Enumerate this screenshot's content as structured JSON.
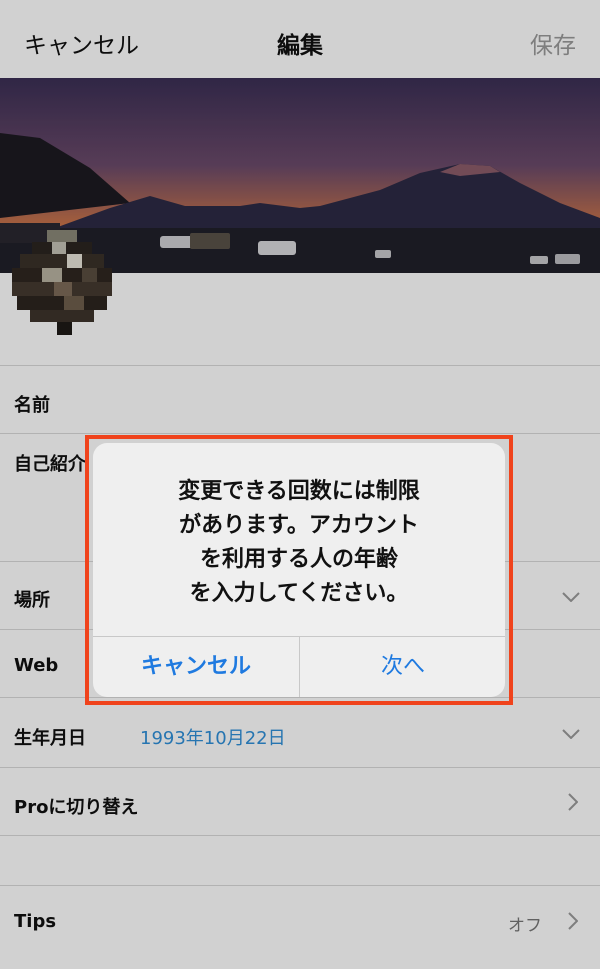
{
  "nav": {
    "cancel_label": "キャンセル",
    "title": "編集",
    "save_label": "保存"
  },
  "rows": {
    "name_label": "名前",
    "bio_label": "自己紹介",
    "location_label": "場所",
    "web_label": "Web",
    "birthday_label": "生年月日",
    "birthday_value": "1993年10月22日",
    "pro_label": "Proに切り替え",
    "tips_label": "Tips",
    "tips_value": "オフ"
  },
  "dialog": {
    "message_lines": [
      "変更できる回数には制限",
      "があります。アカウント",
      "を利用する人の年齢",
      "を入力してください。"
    ],
    "cancel_label": "キャンセル",
    "next_label": "次へ"
  },
  "colors": {
    "accent": "#1f7ae0",
    "highlight": "#f0431c",
    "birthday_value": "#2f8fd8"
  },
  "icons": {
    "location_chevron": "chevron-down-icon",
    "birthday_chevron": "chevron-down-icon",
    "pro_chevron": "chevron-right-icon",
    "tips_chevron": "chevron-right-icon"
  }
}
